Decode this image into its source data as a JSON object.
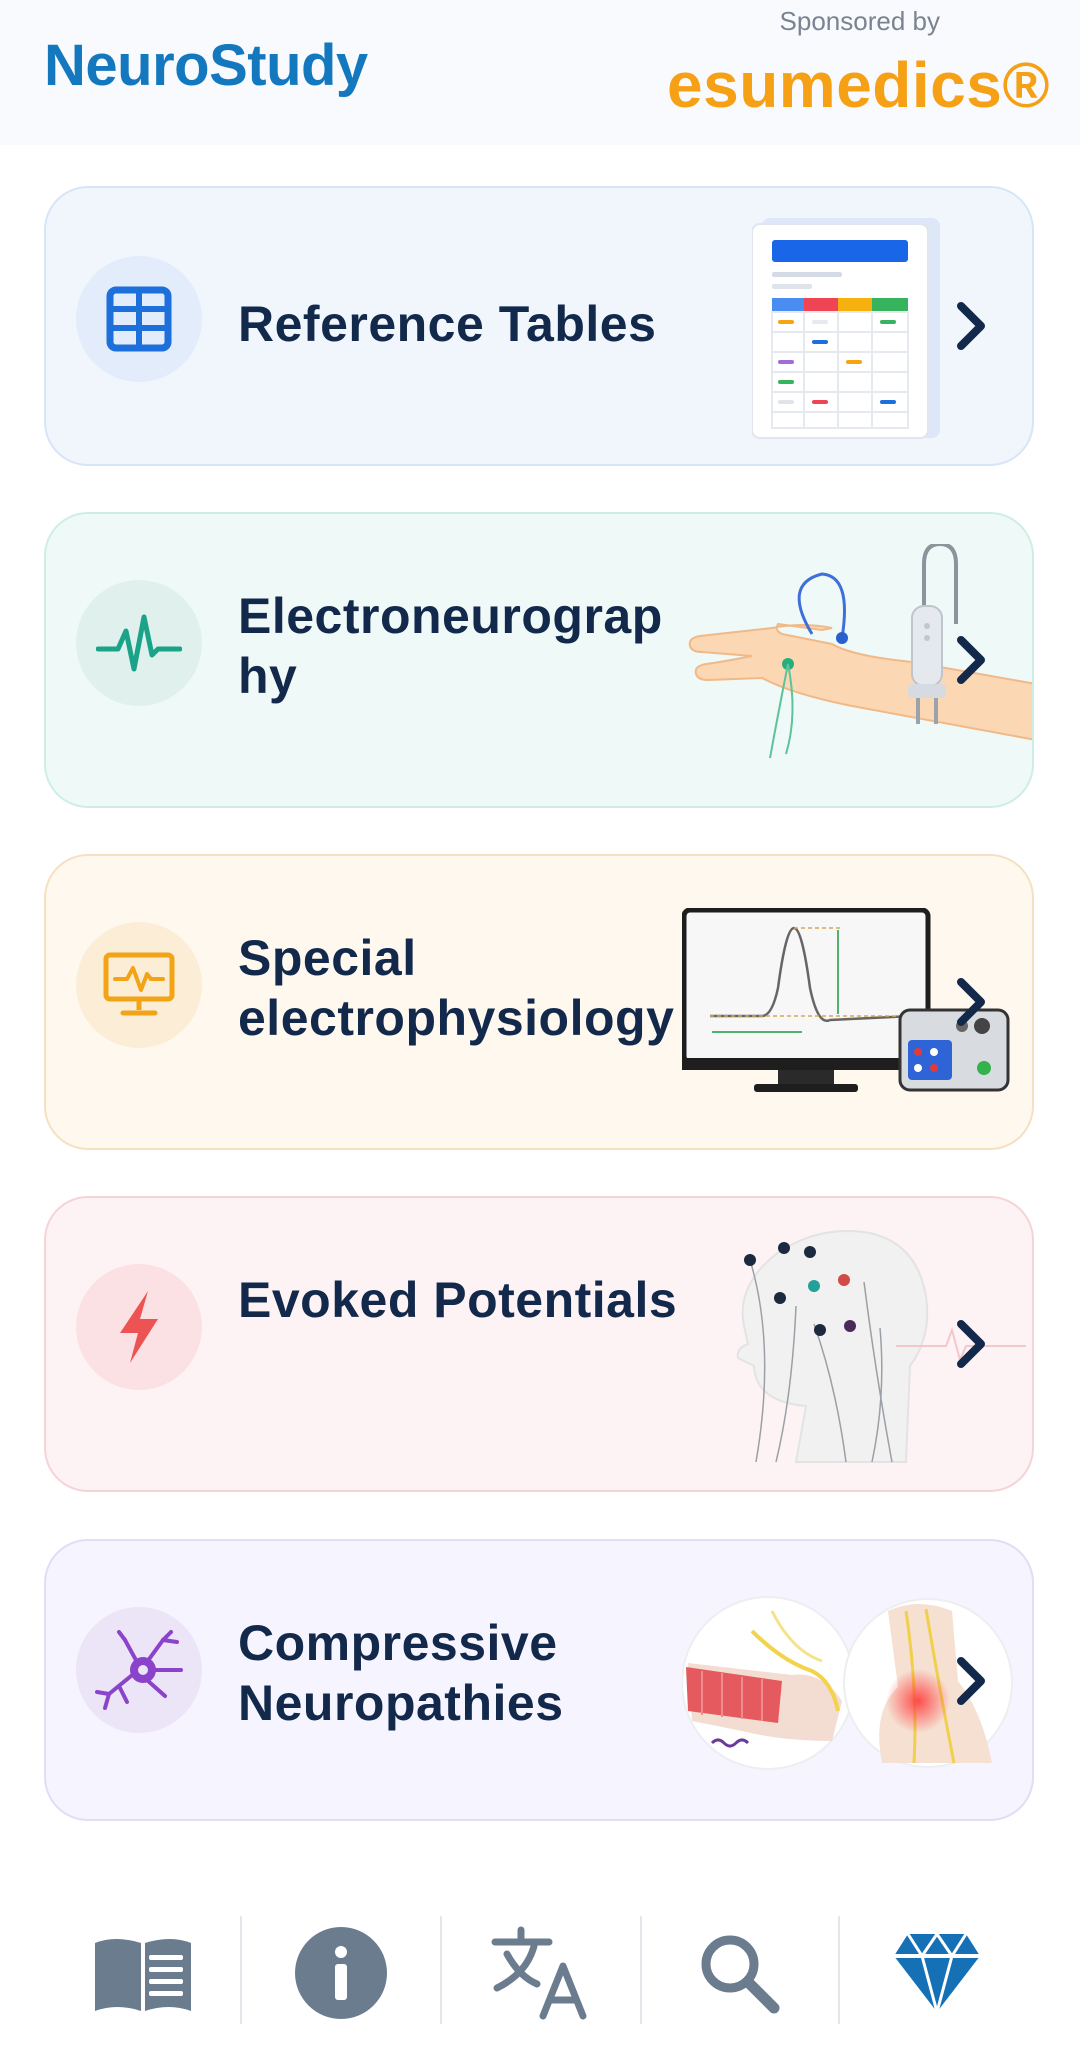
{
  "header": {
    "app_title": "NeuroStudy",
    "sponsored_text": "Sponsored by",
    "sponsor_name": "esumedics®"
  },
  "cards": [
    {
      "label": "Reference Tables",
      "icon": "table-grid-icon",
      "accent": "#1d6fdc"
    },
    {
      "label": "Electroneurograp hy",
      "icon": "pulse-waveform-icon",
      "accent": "#1aa389"
    },
    {
      "label": "Special electrophysiology",
      "icon": "monitor-waveform-icon",
      "accent": "#f2a416"
    },
    {
      "label": "Evoked Potentials",
      "icon": "lightning-bolt-icon",
      "accent": "#ee5353"
    },
    {
      "label": "Compressive Neuropathies",
      "icon": "neuron-icon",
      "accent": "#8b43c9"
    }
  ],
  "bottom_nav": [
    {
      "name": "book-icon"
    },
    {
      "name": "info-icon"
    },
    {
      "name": "translate-icon"
    },
    {
      "name": "search-icon"
    },
    {
      "name": "diamond-icon"
    }
  ]
}
